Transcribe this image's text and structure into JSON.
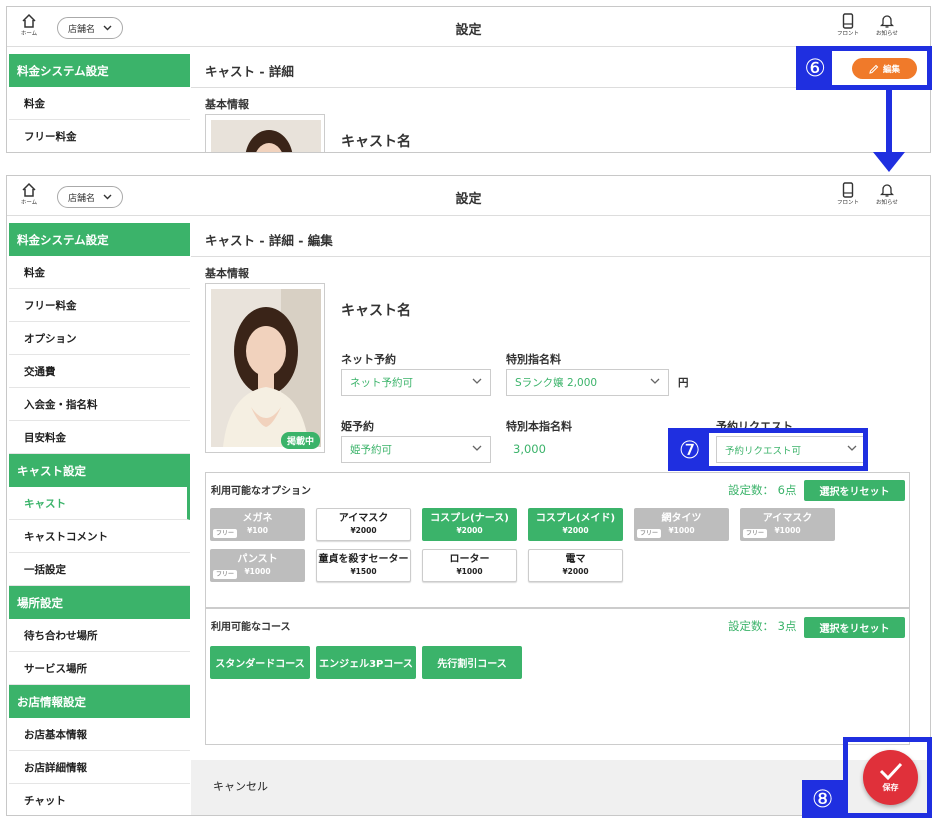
{
  "header": {
    "home_label": "ホーム",
    "store_label": "店舗名",
    "title": "設定",
    "front_label": "フロント",
    "notice_label": "お知らせ"
  },
  "top_panel": {
    "sidebar": {
      "section": "料金システム設定",
      "items": [
        "料金",
        "フリー料金"
      ]
    },
    "main_title": "キャスト - 詳細",
    "edit_button": "編集",
    "basic_info": "基本情報",
    "cast_name": "キャスト名"
  },
  "sidebar": {
    "sections": [
      {
        "title": "料金システム設定",
        "items": [
          "料金",
          "フリー料金",
          "オプション",
          "交通費",
          "入会金・指名料",
          "目安料金"
        ]
      },
      {
        "title": "キャスト設定",
        "items": [
          "キャスト",
          "キャストコメント",
          "一括設定"
        ]
      },
      {
        "title": "場所設定",
        "items": [
          "待ち合わせ場所",
          "サービス場所"
        ]
      },
      {
        "title": "お店情報設定",
        "items": [
          "お店基本情報",
          "お店詳細情報",
          "チャット"
        ]
      }
    ]
  },
  "edit": {
    "title": "キャスト - 詳細 - 編集",
    "basic_info": "基本情報",
    "photo_badge": "掲載中",
    "cast_name": "キャスト名",
    "net_reservation": {
      "label": "ネット予約",
      "value": "ネット予約可"
    },
    "special_fee": {
      "label": "特別指名料",
      "value": "Sランク嬢 2,000",
      "unit": "円"
    },
    "hime_reservation": {
      "label": "姫予約",
      "value": "姫予約可"
    },
    "special_main_fee": {
      "label": "特別本指名料",
      "value": "3,000"
    },
    "reservation_request": {
      "label": "予約リクエスト",
      "value": "予約リクエスト可"
    }
  },
  "options": {
    "title": "利用可能なオプション",
    "count": "設定数： 6点",
    "reset": "選択をリセット",
    "free_tag": "フリー",
    "items": [
      {
        "name": "メガネ",
        "price": "¥100",
        "state": "disabled",
        "free": true
      },
      {
        "name": "アイマスク",
        "price": "¥2000",
        "state": "off",
        "free": false
      },
      {
        "name": "コスプレ(ナース)",
        "price": "¥2000",
        "state": "on",
        "free": false
      },
      {
        "name": "コスプレ(メイド)",
        "price": "¥2000",
        "state": "on",
        "free": false
      },
      {
        "name": "網タイツ",
        "price": "¥1000",
        "state": "disabled",
        "free": true
      },
      {
        "name": "アイマスク",
        "price": "¥1000",
        "state": "disabled",
        "free": true
      },
      {
        "name": "パンスト",
        "price": "¥1000",
        "state": "disabled",
        "free": true
      },
      {
        "name": "童貞を殺すセーター",
        "price": "¥1500",
        "state": "off",
        "free": false
      },
      {
        "name": "ローター",
        "price": "¥1000",
        "state": "off",
        "free": false
      },
      {
        "name": "電マ",
        "price": "¥2000",
        "state": "off",
        "free": false
      }
    ]
  },
  "courses": {
    "title": "利用可能なコース",
    "count": "設定数： 3点",
    "reset": "選択をリセット",
    "items": [
      "スタンダードコース",
      "エンジェル3Pコース",
      "先行割引コース"
    ]
  },
  "footer": {
    "cancel": "キャンセル",
    "save": "保存"
  },
  "callouts": [
    "⑥",
    "⑦",
    "⑧"
  ],
  "colors": {
    "accent": "#3bb36a",
    "edit": "#f07a2a",
    "save": "#e0303a",
    "callout": "#1f2fe0"
  }
}
